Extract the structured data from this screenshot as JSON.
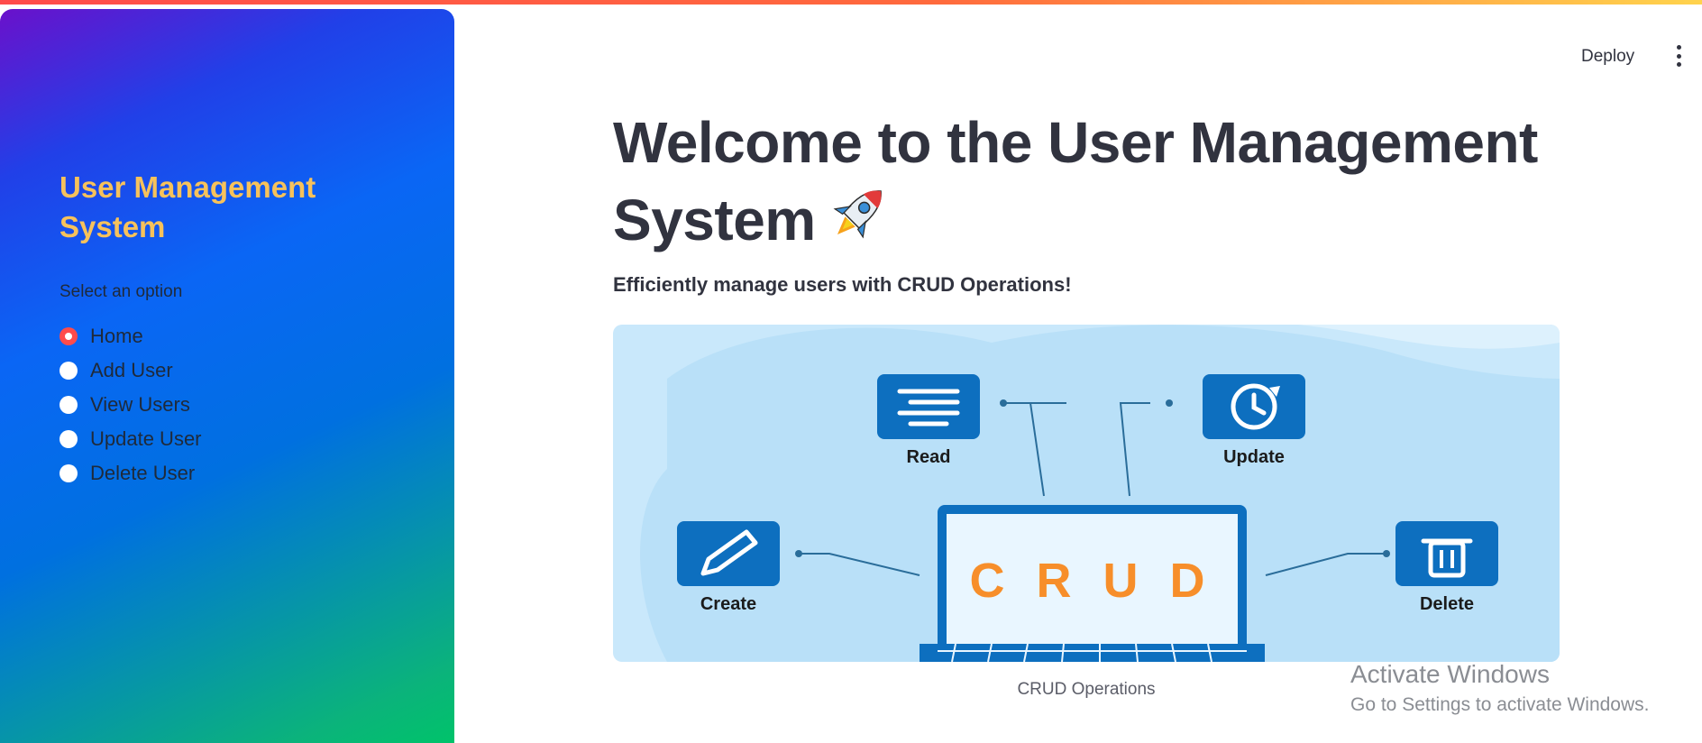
{
  "sidebar": {
    "title": "User Management System",
    "radio_label": "Select an option",
    "options": [
      {
        "label": "Home",
        "selected": true
      },
      {
        "label": "Add User",
        "selected": false
      },
      {
        "label": "View Users",
        "selected": false
      },
      {
        "label": "Update User",
        "selected": false
      },
      {
        "label": "Delete User",
        "selected": false
      }
    ]
  },
  "header": {
    "deploy_label": "Deploy",
    "menu_icon": "kebab-menu-icon"
  },
  "main": {
    "title": "Welcome to the User Management System",
    "title_emoji": "rocket-icon",
    "subtitle": "Efficiently manage users with CRUD Operations!",
    "image": {
      "center_text": "C R U D",
      "items": [
        "Read",
        "Update",
        "Create",
        "Delete"
      ],
      "caption": "CRUD Operations"
    }
  },
  "watermark": {
    "title": "Activate Windows",
    "subtitle": "Go to Settings to activate Windows."
  },
  "colors": {
    "accent": "#ff4b4b",
    "sidebar_title": "#f7c25b",
    "text": "#31333f",
    "crud_orange": "#f78e2a",
    "card_blue": "#0d6fbf"
  }
}
